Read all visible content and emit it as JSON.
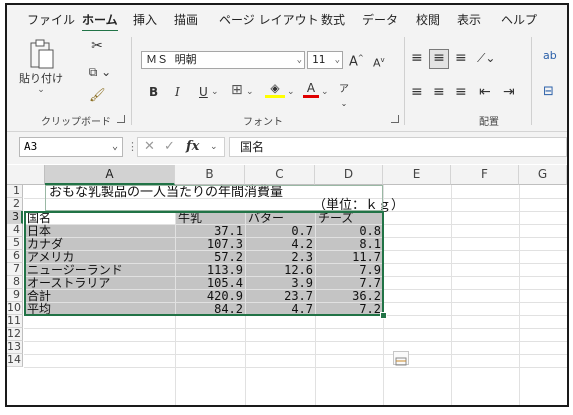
{
  "menu": {
    "tabs": [
      "ファイル",
      "ホーム",
      "挿入",
      "描画",
      "ページ レイアウト",
      "数式",
      "データ",
      "校閲",
      "表示",
      "ヘルプ"
    ],
    "active": "ホーム"
  },
  "ribbon": {
    "paste_label": "貼り付け",
    "clipboard_label": "クリップボード",
    "font_label": "フォント",
    "alignment_label": "配置",
    "font_name": "ＭＳ 明朝",
    "font_size": "11",
    "bold": "B",
    "italic": "I",
    "underline": "U",
    "grow": "A",
    "shrink": "A",
    "font_color": "A",
    "phonetic": "ア",
    "wrap_icon": "ab"
  },
  "formula_bar": {
    "name_box": "A3",
    "fx": "fx",
    "value": "国名"
  },
  "grid": {
    "columns": [
      "A",
      "B",
      "C",
      "D",
      "E",
      "F",
      "G"
    ],
    "selected_column": "A",
    "rows": [
      "1",
      "2",
      "3",
      "4",
      "5",
      "6",
      "7",
      "8",
      "9",
      "10",
      "11",
      "12",
      "13",
      "14"
    ],
    "selected_row": "3",
    "title": "おもな乳製品の一人当たりの年間消費量",
    "unit": "（単位：ｋｇ）",
    "headers": [
      "国名",
      "牛乳",
      "バター",
      "チーズ"
    ],
    "table": [
      {
        "country": "日本",
        "milk": "37.1",
        "butter": "0.7",
        "cheese": "0.8"
      },
      {
        "country": "カナダ",
        "milk": "107.3",
        "butter": "4.2",
        "cheese": "8.1"
      },
      {
        "country": "アメリカ",
        "milk": "57.2",
        "butter": "2.3",
        "cheese": "11.7"
      },
      {
        "country": "ニュージーランド",
        "milk": "113.9",
        "butter": "12.6",
        "cheese": "7.9"
      },
      {
        "country": "オーストラリア",
        "milk": "105.4",
        "butter": "3.9",
        "cheese": "7.7"
      },
      {
        "country": "合計",
        "milk": "420.9",
        "butter": "23.7",
        "cheese": "36.2"
      },
      {
        "country": "平均",
        "milk": "84.2",
        "butter": "4.7",
        "cheese": "7.2"
      }
    ]
  },
  "colors": {
    "accent": "#217346",
    "selection_fill": "#c4c4c4",
    "ribbon_bg": "#f3f3f3"
  }
}
